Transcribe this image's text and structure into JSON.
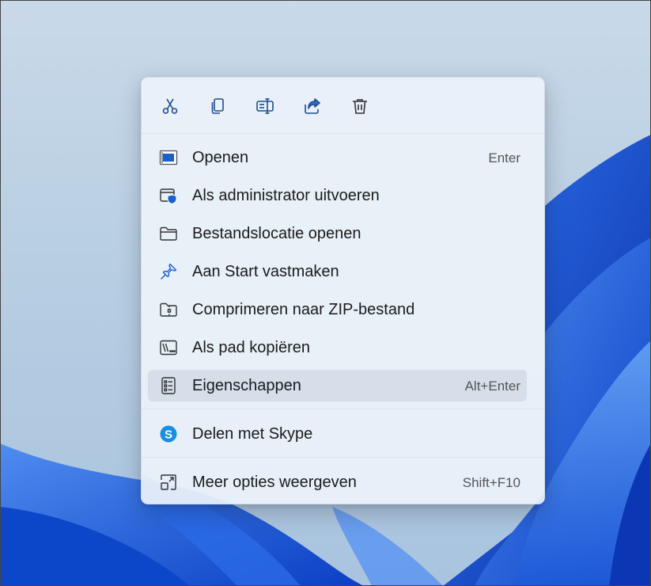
{
  "toolbar": {
    "buttons": [
      {
        "icon": "cut-icon"
      },
      {
        "icon": "copy-icon"
      },
      {
        "icon": "rename-icon"
      },
      {
        "icon": "share-icon"
      },
      {
        "icon": "delete-icon"
      }
    ]
  },
  "menu": {
    "items": [
      {
        "label": "Openen",
        "shortcut": "Enter",
        "icon": "open-app-icon"
      },
      {
        "label": "Als administrator uitvoeren",
        "shortcut": "",
        "icon": "admin-shield-icon"
      },
      {
        "label": "Bestandslocatie openen",
        "shortcut": "",
        "icon": "folder-icon"
      },
      {
        "label": "Aan Start vastmaken",
        "shortcut": "",
        "icon": "pin-icon"
      },
      {
        "label": "Comprimeren naar ZIP-bestand",
        "shortcut": "",
        "icon": "zip-folder-icon"
      },
      {
        "label": "Als pad kopiëren",
        "shortcut": "",
        "icon": "copy-path-icon"
      },
      {
        "label": "Eigenschappen",
        "shortcut": "Alt+Enter",
        "icon": "properties-icon",
        "highlighted": true
      },
      {
        "label": "Delen met Skype",
        "shortcut": "",
        "icon": "skype-icon"
      },
      {
        "label": "Meer opties weergeven",
        "shortcut": "Shift+F10",
        "icon": "more-options-icon"
      }
    ]
  },
  "colors": {
    "accent": "#0f6cbd",
    "menu_background": "#ecf2fa",
    "highlight": "#c6d0dc",
    "text": "#1b1b1b",
    "shortcut_text": "#555555",
    "wallpaper_blue": "#1565e0",
    "desktop_background": "#bcd0e4"
  }
}
